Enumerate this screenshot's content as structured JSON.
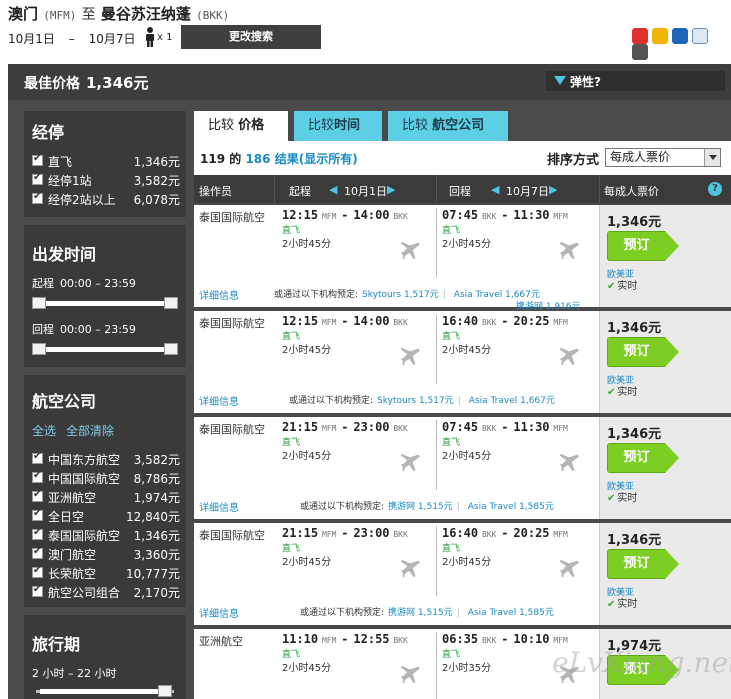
{
  "header": {
    "origin_city": "澳门",
    "origin_code": "(MFM)",
    "to_word": "至",
    "dest_city": "曼谷苏汪纳蓬",
    "dest_code": "(BKK)",
    "depart_date": "10月1日",
    "date_dash": "–",
    "return_date": "10月7日",
    "pax_count": "x 1",
    "modify_label": "更改搜索",
    "share_icons": [
      "weibo-icon",
      "qzone-icon",
      "renren-icon",
      "mail-icon",
      "print-icon"
    ]
  },
  "best": {
    "label": "最佳价格",
    "value": "1,346元",
    "flex_label": "弹性?"
  },
  "sidebar": {
    "stops_title": "经停",
    "stops": [
      {
        "label": "直飞",
        "count": "1,346元"
      },
      {
        "label": "经停1站",
        "count": "3,582元"
      },
      {
        "label": "经停2站以上",
        "count": "6,078元"
      }
    ],
    "time_title": "出发时间",
    "outbound_label": "起程",
    "outbound_range": "00:00 – 23:59",
    "return_label": "回程",
    "return_range": "00:00 – 23:59",
    "airlines_title": "航空公司",
    "select_all": "全选",
    "clear_all": "全部清除",
    "airlines": [
      {
        "label": "中国东方航空",
        "count": "3,582元"
      },
      {
        "label": "中国国际航空",
        "count": "8,786元"
      },
      {
        "label": "亚洲航空",
        "count": "1,974元"
      },
      {
        "label": "全日空",
        "count": "12,840元"
      },
      {
        "label": "泰国国际航空",
        "count": "1,346元"
      },
      {
        "label": "澳门航空",
        "count": "3,360元"
      },
      {
        "label": "长荣航空",
        "count": "10,777元"
      },
      {
        "label": "航空公司组合",
        "count": "2,170元"
      }
    ],
    "duration_title": "旅行期",
    "duration_range": "2 小时 – 22 小时"
  },
  "tabs": [
    {
      "prefix": "比较",
      "bold": "价格"
    },
    {
      "prefix": "比较",
      "bold": "时间"
    },
    {
      "prefix": "比较",
      "bold": "航空公司"
    }
  ],
  "results": {
    "shown": "119",
    "of_word": "的",
    "total": "186",
    "suffix": "结果",
    "show_all": "(显示所有)",
    "sort_label": "排序方式",
    "sort_value": "每成人票价"
  },
  "columns": {
    "operator": "操作员",
    "depart": "起程",
    "depart_date": "10月1日",
    "return": "回程",
    "return_date": "10月7日",
    "price": "每成人票价",
    "help": "?"
  },
  "flights": [
    {
      "airline": "泰国国际航空",
      "out_dep": "12:15",
      "out_dep_ap": "MFM",
      "out_arr": "14:00",
      "out_arr_ap": "BKK",
      "out_stops": "直飞",
      "out_dur": "2小时45分",
      "ret_dep": "07:45",
      "ret_dep_ap": "BKK",
      "ret_arr": "11:30",
      "ret_arr_ap": "MFM",
      "ret_stops": "直飞",
      "ret_dur": "2小时45分",
      "price": "1,346元",
      "book": "预订",
      "source": "欧美亚",
      "realtime": "实时",
      "details": "详细信息",
      "also": "或通过以下机构预定:",
      "agents": [
        "Skytours 1,517元",
        "Asia Travel 1,667元"
      ],
      "agents2": "携游网 1,916元"
    },
    {
      "airline": "泰国国际航空",
      "out_dep": "12:15",
      "out_dep_ap": "MFM",
      "out_arr": "14:00",
      "out_arr_ap": "BKK",
      "out_stops": "直飞",
      "out_dur": "2小时45分",
      "ret_dep": "16:40",
      "ret_dep_ap": "BKK",
      "ret_arr": "20:25",
      "ret_arr_ap": "MFM",
      "ret_stops": "直飞",
      "ret_dur": "2小时45分",
      "price": "1,346元",
      "book": "预订",
      "source": "欧美亚",
      "realtime": "实时",
      "details": "详细信息",
      "also": "或通过以下机构预定:",
      "agents": [
        "Skytours 1,517元",
        "Asia Travel 1,667元"
      ],
      "agents2": ""
    },
    {
      "airline": "泰国国际航空",
      "out_dep": "21:15",
      "out_dep_ap": "MFM",
      "out_arr": "23:00",
      "out_arr_ap": "BKK",
      "out_stops": "直飞",
      "out_dur": "2小时45分",
      "ret_dep": "07:45",
      "ret_dep_ap": "BKK",
      "ret_arr": "11:30",
      "ret_arr_ap": "MFM",
      "ret_stops": "直飞",
      "ret_dur": "2小时45分",
      "price": "1,346元",
      "book": "预订",
      "source": "欧美亚",
      "realtime": "实时",
      "details": "详细信息",
      "also": "或通过以下机构预定:",
      "agents": [
        "携游网 1,515元",
        "Asia Travel 1,585元"
      ],
      "agents2": ""
    },
    {
      "airline": "泰国国际航空",
      "out_dep": "21:15",
      "out_dep_ap": "MFM",
      "out_arr": "23:00",
      "out_arr_ap": "BKK",
      "out_stops": "直飞",
      "out_dur": "2小时45分",
      "ret_dep": "16:40",
      "ret_dep_ap": "BKK",
      "ret_arr": "20:25",
      "ret_arr_ap": "MFM",
      "ret_stops": "直飞",
      "ret_dur": "2小时45分",
      "price": "1,346元",
      "book": "预订",
      "source": "欧美亚",
      "realtime": "实时",
      "details": "详细信息",
      "also": "或通过以下机构预定:",
      "agents": [
        "携游网 1,515元",
        "Asia Travel 1,585元"
      ],
      "agents2": ""
    },
    {
      "airline": "亚洲航空",
      "out_dep": "11:10",
      "out_dep_ap": "MFM",
      "out_arr": "12:55",
      "out_arr_ap": "BKK",
      "out_stops": "直飞",
      "out_dur": "2小时45分",
      "ret_dep": "06:35",
      "ret_dep_ap": "BKK",
      "ret_arr": "10:10",
      "ret_arr_ap": "MFM",
      "ret_stops": "直飞",
      "ret_dur": "2小时35分",
      "price": "1,974元",
      "book": "预订",
      "source": "",
      "realtime": "",
      "details": "",
      "also": "",
      "agents": [],
      "agents2": ""
    }
  ],
  "watermark": "eLvXiang.net",
  "colors": {
    "accent": "#5ccfe6",
    "book_green": "#7ccf22",
    "link_blue": "#1a8ac4",
    "frame_dark": "#4a4a4a"
  }
}
